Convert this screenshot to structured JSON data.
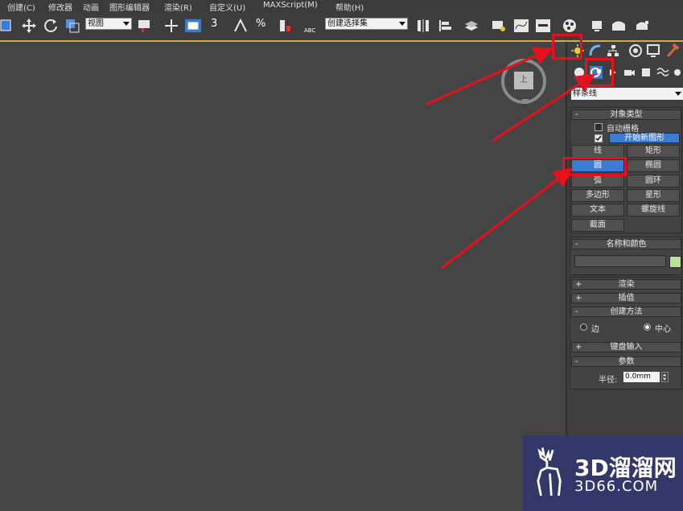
{
  "menu": {
    "items": [
      "创建(C)",
      "修改器",
      "动画",
      "图形编辑器",
      "渲染(R)",
      "自定义(U)",
      "MAXScript(M)",
      "帮助(H)"
    ]
  },
  "toolbar": {
    "view_dropdown": "视图",
    "selection_set_placeholder": "创建选择集",
    "snap_label": "3",
    "angle_snap_label": "%",
    "abc_label": "ABC"
  },
  "viewcube": {
    "face_label": "上"
  },
  "command_panel": {
    "category_dropdown": "样条线",
    "object_type": {
      "title": "对象类型",
      "auto_grid": "自动栅格",
      "start_new_shape": "开始新图形",
      "auto_grid_checked": false,
      "start_new_shape_checked": true,
      "buttons": [
        {
          "label": "线",
          "active": false
        },
        {
          "label": "矩形",
          "active": false
        },
        {
          "label": "圆",
          "active": true
        },
        {
          "label": "椭圆",
          "active": false
        },
        {
          "label": "弧",
          "active": false
        },
        {
          "label": "圆环",
          "active": false
        },
        {
          "label": "多边形",
          "active": false
        },
        {
          "label": "星形",
          "active": false
        },
        {
          "label": "文本",
          "active": false
        },
        {
          "label": "螺旋线",
          "active": false
        },
        {
          "label": "截面",
          "active": false
        }
      ]
    },
    "name_color": {
      "title": "名称和颜色",
      "name_value": "",
      "color": "#b8e39b"
    },
    "rollouts": {
      "render": "渲染",
      "interpolation": "插值",
      "creation_method": "创建方法",
      "keyboard_input": "键盘输入",
      "parameters": "参数"
    },
    "creation_method": {
      "edge": "边",
      "center": "中心",
      "selected": "中心"
    },
    "parameters": {
      "radius_label": "半径:",
      "radius_value": "0.0mm"
    }
  },
  "watermark": {
    "brand": "3D溜溜网",
    "domain": "3D66.COM"
  },
  "colors": {
    "accent_highlight": "#3a7bd5",
    "annotation_red": "#e8101a",
    "viewport_bg": "#444444"
  }
}
